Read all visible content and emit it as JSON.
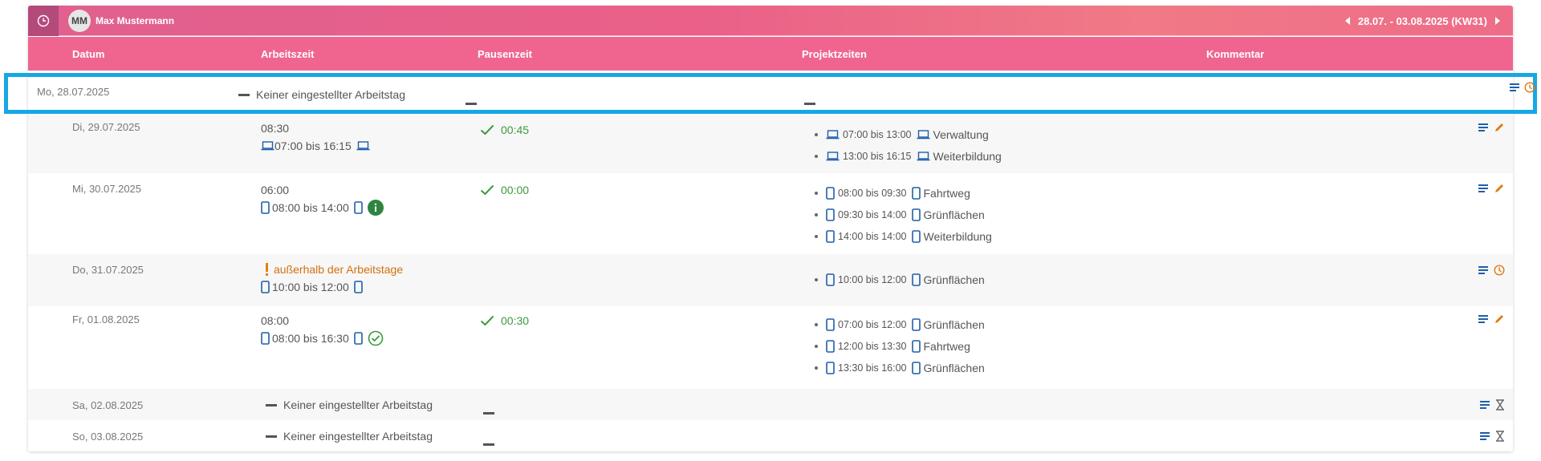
{
  "header": {
    "avatar_initials": "MM",
    "user_name": "Max Mustermann",
    "week_range": "28.07. - 03.08.2025 (KW31)"
  },
  "columns": {
    "datum": "Datum",
    "arbeitszeit": "Arbeitszeit",
    "pausenzeit": "Pausenzeit",
    "projektzeiten": "Projektzeiten",
    "kommentar": "Kommentar"
  },
  "rows": [
    {
      "date": "Mo, 28.07.2025",
      "work_none": "Keiner eingestellter Arbeitstag"
    },
    {
      "date": "Di, 29.07.2025",
      "work_hours": "08:30",
      "work_span": "07:00 bis 16:15",
      "pause": "00:45",
      "projects": [
        {
          "time": "07:00 bis 13:00",
          "name": "Verwaltung"
        },
        {
          "time": "13:00 bis 16:15",
          "name": "Weiterbildung"
        }
      ]
    },
    {
      "date": "Mi, 30.07.2025",
      "work_hours": "06:00",
      "work_span": "08:00 bis 14:00",
      "pause": "00:00",
      "projects": [
        {
          "time": "08:00 bis 09:30",
          "name": "Fahrtweg"
        },
        {
          "time": "09:30 bis 14:00",
          "name": "Grünflächen"
        },
        {
          "time": "14:00 bis 14:00",
          "name": "Weiterbildung"
        }
      ]
    },
    {
      "date": "Do, 31.07.2025",
      "warning": "außerhalb der Arbeitstage",
      "work_span": "10:00 bis 12:00",
      "projects": [
        {
          "time": "10:00 bis 12:00",
          "name": "Grünflächen"
        }
      ]
    },
    {
      "date": "Fr, 01.08.2025",
      "work_hours": "08:00",
      "work_span": "08:00 bis 16:30",
      "pause": "00:30",
      "projects": [
        {
          "time": "07:00 bis 12:00",
          "name": "Grünflächen"
        },
        {
          "time": "12:00 bis 13:30",
          "name": "Fahrtweg"
        },
        {
          "time": "13:30 bis 16:00",
          "name": "Grünflächen"
        }
      ]
    },
    {
      "date": "Sa, 02.08.2025",
      "work_none": "Keiner eingestellter Arbeitstag"
    },
    {
      "date": "So, 03.08.2025",
      "work_none": "Keiner eingestellter Arbeitstag"
    }
  ],
  "colors": {
    "accent_pink": "#ef6590",
    "highlight_blue": "#15a8e4",
    "device_blue": "#1f5fa8",
    "ok_green": "#3d9a3d",
    "warn_orange": "#d5700c"
  }
}
